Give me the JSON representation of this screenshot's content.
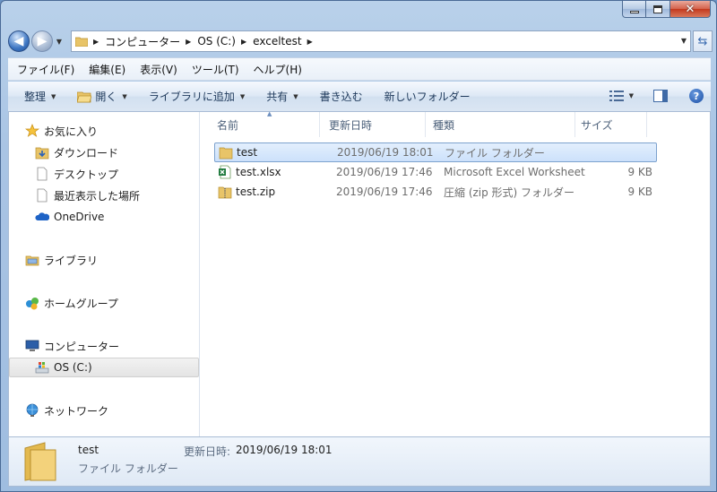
{
  "window": {
    "caption_buttons": [
      "minimize",
      "maximize",
      "close"
    ]
  },
  "address": {
    "crumbs": [
      "コンピューター",
      "OS (C:)",
      "exceltest"
    ]
  },
  "menubar": {
    "items": [
      "ファイル(F)",
      "編集(E)",
      "表示(V)",
      "ツール(T)",
      "ヘルプ(H)"
    ]
  },
  "toolbar": {
    "organize": "整理",
    "open": "開く",
    "library": "ライブラリに追加",
    "share": "共有",
    "burn": "書き込む",
    "new_folder": "新しいフォルダー"
  },
  "navpane": {
    "favorites": "お気に入り",
    "downloads": "ダウンロード",
    "desktop": "デスクトップ",
    "recent": "最近表示した場所",
    "onedrive": "OneDrive",
    "libraries": "ライブラリ",
    "homegroup": "ホームグループ",
    "computer": "コンピューター",
    "drive_c": "OS (C:)",
    "network": "ネットワーク"
  },
  "columns": {
    "name": "名前",
    "modified": "更新日時",
    "type": "種類",
    "size": "サイズ"
  },
  "files": [
    {
      "name": "test",
      "modified": "2019/06/19 18:01",
      "type": "ファイル フォルダー",
      "size": "",
      "icon": "folder-icon",
      "selected": true
    },
    {
      "name": "test.xlsx",
      "modified": "2019/06/19 17:46",
      "type": "Microsoft Excel Worksheet",
      "size": "9 KB",
      "icon": "excel-file-icon",
      "selected": false
    },
    {
      "name": "test.zip",
      "modified": "2019/06/19 17:46",
      "type": "圧縮 (zip 形式) フォルダー",
      "size": "9 KB",
      "icon": "zip-folder-icon",
      "selected": false
    }
  ],
  "details": {
    "name": "test",
    "type": "ファイル フォルダー",
    "modified_label": "更新日時:",
    "modified_value": "2019/06/19 18:01"
  },
  "colors": {
    "accent": "#3f77c3",
    "selection": "#cce1fb",
    "folder": "#e8c468"
  }
}
